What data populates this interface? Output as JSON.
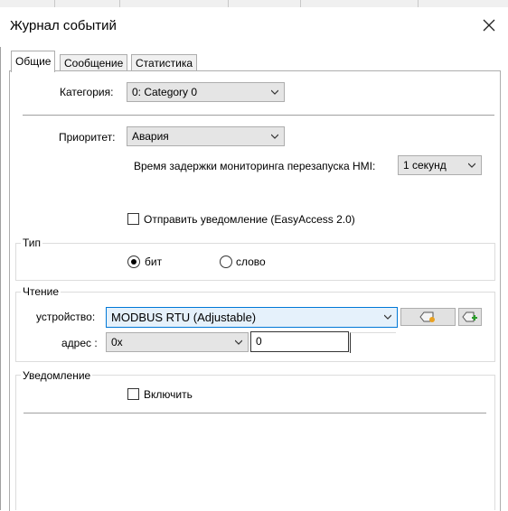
{
  "window": {
    "title": "Журнал событий"
  },
  "tabs": [
    {
      "label": "Общие",
      "active": true
    },
    {
      "label": "Сообщение",
      "active": false
    },
    {
      "label": "Статистика",
      "active": false
    }
  ],
  "general": {
    "category_label": "Категория:",
    "category_value": "0: Category 0",
    "priority_label": "Приоритет:",
    "priority_value": "Авария",
    "delay_label": "Время задержки мониторинга перезапуска HMI:",
    "delay_value": "1 секунд",
    "notify_label": "Отправить уведомление (EasyAccess 2.0)",
    "notify_checked": false
  },
  "type_group": {
    "title": "Тип",
    "options": [
      {
        "label": "бит",
        "selected": true
      },
      {
        "label": "слово",
        "selected": false
      }
    ]
  },
  "read_group": {
    "title": "Чтение",
    "device_label": "устройство:",
    "device_value": "MODBUS RTU (Adjustable)",
    "address_label": "адрес :",
    "address_type": "0x",
    "address_value": "0"
  },
  "notification_group": {
    "title": "Уведомление",
    "enable_label": "Включить",
    "enable_checked": false
  },
  "icons": {
    "close": "close-icon",
    "dropdown": "chevron-down-icon",
    "tag": "tag-icon",
    "tag_add": "tag-add-icon"
  }
}
